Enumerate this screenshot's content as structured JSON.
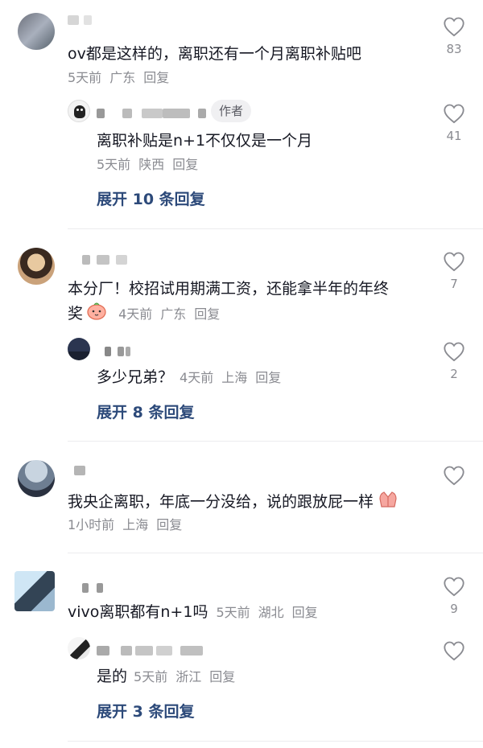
{
  "comments": [
    {
      "text": "ov都是这样的，离职还有一个月离职补贴吧",
      "meta": [
        "5天前",
        "广东",
        "回复"
      ],
      "likes": "83",
      "reply": {
        "author_tag": "作者",
        "text": "离职补贴是n+1不仅仅是一个月",
        "meta": [
          "5天前",
          "陕西",
          "回复"
        ],
        "likes": "41"
      },
      "expand": "展开 10 条回复"
    },
    {
      "text_line1": "本分厂！校招试用期满工资，还能拿半年的年终",
      "text_line2": "奖",
      "meta": [
        "4天前",
        "广东",
        "回复"
      ],
      "likes": "7",
      "reply": {
        "text": "多少兄弟？",
        "meta": [
          "4天前",
          "上海",
          "回复"
        ],
        "likes": "2"
      },
      "expand": "展开 8 条回复"
    },
    {
      "text": "我央企离职，年底一分没给，说的跟放屁一样",
      "meta": [
        "1小时前",
        "上海",
        "回复"
      ]
    },
    {
      "text": "vivo离职都有n+1吗",
      "meta": [
        "5天前",
        "湖北",
        "回复"
      ],
      "likes": "9",
      "reply": {
        "text": "是的",
        "meta": [
          "5天前",
          "浙江",
          "回复"
        ]
      },
      "expand": "展开 3 条回复"
    }
  ],
  "colors": {
    "text": "#161823",
    "meta": "#8a8b91",
    "expand": "#2d4a7a",
    "author_tag_bg": "#f0f0f2"
  }
}
